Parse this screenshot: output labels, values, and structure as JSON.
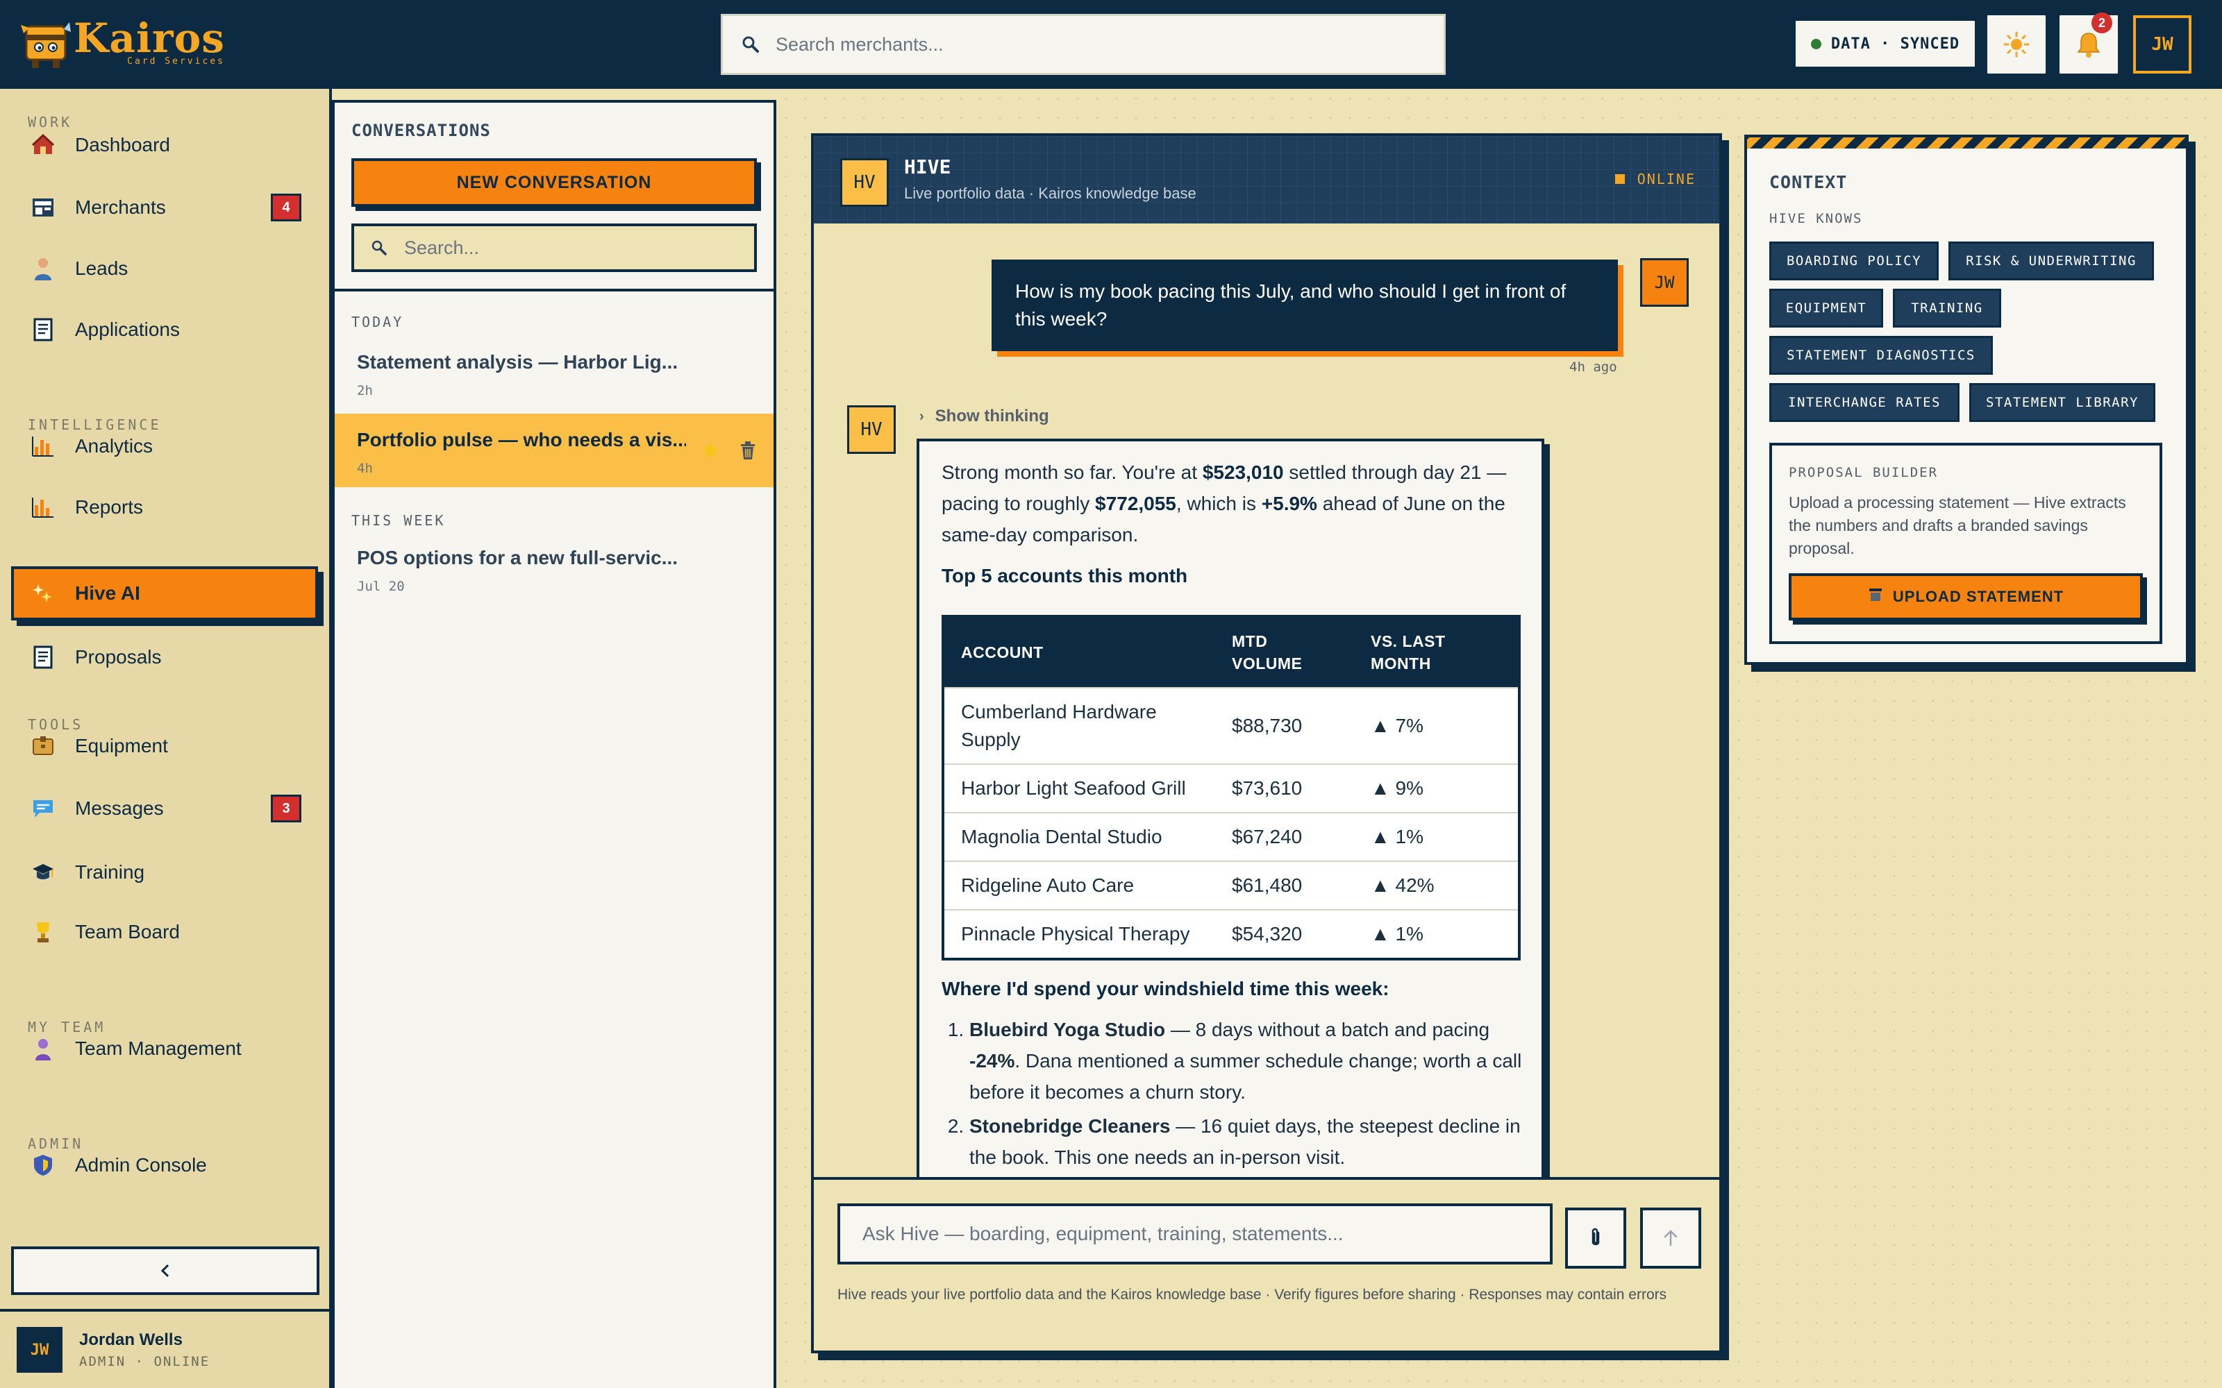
{
  "app": {
    "name": "Kairos",
    "tagline": "Card Services",
    "search_placeholder": "Search merchants...",
    "sync_status": "DATA · SYNCED",
    "notification_count": "2",
    "user_initials": "JW",
    "colors": {
      "navy": "#0c2a42",
      "orange": "#f6830f",
      "amber": "#f5a623",
      "cream": "#ede3b5",
      "sidebar": "#e6d9a7",
      "danger": "#d32f2f",
      "online": "#2e7d32"
    }
  },
  "sidebar": {
    "sections": [
      {
        "label": "WORK"
      },
      {
        "label": "INTELLIGENCE"
      },
      {
        "label": "TOOLS"
      },
      {
        "label": "MY TEAM"
      },
      {
        "label": "ADMIN"
      }
    ],
    "items": [
      {
        "label": "Dashboard",
        "icon": "house-icon"
      },
      {
        "label": "Merchants",
        "icon": "storefront-icon",
        "badge": "4"
      },
      {
        "label": "Leads",
        "icon": "person-icon"
      },
      {
        "label": "Applications",
        "icon": "document-icon"
      },
      {
        "label": "Analytics",
        "icon": "bar-chart-icon"
      },
      {
        "label": "Reports",
        "icon": "report-chart-icon"
      },
      {
        "label": "Hive AI",
        "icon": "sparkle-icon",
        "active": true
      },
      {
        "label": "Proposals",
        "icon": "document-icon"
      },
      {
        "label": "Equipment",
        "icon": "package-icon"
      },
      {
        "label": "Messages",
        "icon": "chat-bubble-icon",
        "badge": "3"
      },
      {
        "label": "Training",
        "icon": "graduation-cap-icon"
      },
      {
        "label": "Team Board",
        "icon": "trophy-icon"
      },
      {
        "label": "Team Management",
        "icon": "team-member-icon"
      },
      {
        "label": "Admin Console",
        "icon": "shield-icon"
      }
    ],
    "user": {
      "initials": "JW",
      "name": "Jordan Wells",
      "role": "ADMIN · ONLINE"
    }
  },
  "conversations": {
    "title": "CONVERSATIONS",
    "new_label": "NEW CONVERSATION",
    "search_placeholder": "Search...",
    "groups": [
      {
        "label": "TODAY"
      },
      {
        "label": "THIS WEEK"
      }
    ],
    "items": [
      {
        "title": "Statement analysis — Harbor Lig...",
        "time": "2h"
      },
      {
        "title": "Portfolio pulse — who needs a vis...",
        "time": "4h",
        "active": true
      },
      {
        "title": "POS options for a new full-servic...",
        "time": "Jul 20"
      }
    ]
  },
  "chat": {
    "bot_initials": "HV",
    "bot_name": "HIVE",
    "bot_subtitle": "Live portfolio data · Kairos knowledge base",
    "status": "ONLINE",
    "user_message": "How is my book pacing this July, and who should I get in front of this week?",
    "user_initials": "JW",
    "user_time": "4h ago",
    "show_thinking": "Show thinking",
    "reply": {
      "p1_a": "Strong month so far. You're at ",
      "p1_settled": "$523,010",
      "p1_b": " settled through day 21 — pacing to roughly ",
      "p1_pace": "$772,055",
      "p1_c": ", which is ",
      "p1_delta": "+5.9%",
      "p1_d": " ahead of June on the same-day comparison.",
      "top_heading": "Top 5 accounts this month",
      "table": {
        "headers": [
          "ACCOUNT",
          "MTD VOLUME",
          "VS. LAST MONTH"
        ],
        "rows": [
          [
            "Cumberland Hardware Supply",
            "$88,730",
            "▲ 7%"
          ],
          [
            "Harbor Light Seafood Grill",
            "$73,610",
            "▲ 9%"
          ],
          [
            "Magnolia Dental Studio",
            "$67,240",
            "▲ 1%"
          ],
          [
            "Ridgeline Auto Care",
            "$61,480",
            "▲ 42%"
          ],
          [
            "Pinnacle Physical Therapy",
            "$54,320",
            "▲ 1%"
          ]
        ]
      },
      "windshield_heading": "Where I'd spend your windshield time this week:",
      "list": [
        {
          "name": "Bluebird Yoga Studio",
          "text_a": " — 8 days without a batch and pacing ",
          "bold": "-24%",
          "text_b": ". Dana mentioned a summer schedule change; worth a call before it becomes a churn story."
        },
        {
          "name": "Stonebridge Cleaners",
          "text_a": " — 16 quiet days, the steepest decline in the book. This one needs an in-person visit.",
          "bold": "",
          "text_b": ""
        }
      ]
    },
    "composer_placeholder": "Ask Hive — boarding, equipment, training, statements...",
    "disclaimer": "Hive reads your live portfolio data and the Kairos knowledge base · Verify figures before sharing · Responses may contain errors"
  },
  "context": {
    "title": "CONTEXT",
    "subtitle": "HIVE KNOWS",
    "chips": [
      "BOARDING POLICY",
      "RISK & UNDERWRITING",
      "EQUIPMENT",
      "TRAINING",
      "STATEMENT DIAGNOSTICS",
      "INTERCHANGE RATES",
      "STATEMENT LIBRARY"
    ],
    "proposal": {
      "label": "PROPOSAL BUILDER",
      "text": "Upload a processing statement — Hive extracts the numbers and drafts a branded savings proposal.",
      "button": "UPLOAD STATEMENT"
    }
  }
}
